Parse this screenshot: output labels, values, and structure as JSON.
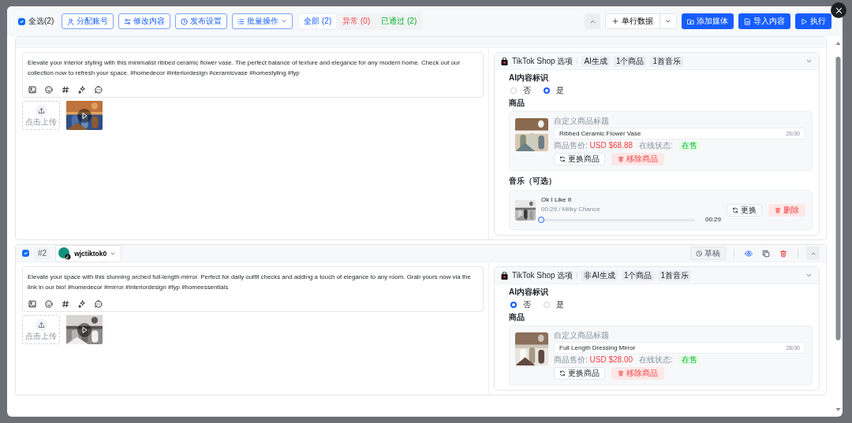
{
  "toolbar": {
    "select_all": {
      "label": "全选(2)",
      "checked": true
    },
    "actions": [
      {
        "label": "分配账号",
        "dropdown": false
      },
      {
        "label": "修改内容",
        "dropdown": false
      },
      {
        "label": "发布设置",
        "dropdown": false
      },
      {
        "label": "批量操作",
        "dropdown": true
      }
    ],
    "filters": [
      {
        "label": "全部 (2)",
        "kind": "all",
        "selected": true
      },
      {
        "label": "异常 (0)",
        "kind": "error",
        "selected": false
      },
      {
        "label": "已通过 (2)",
        "kind": "passed",
        "selected": false
      }
    ],
    "row_add": {
      "label": "单行数据"
    },
    "primary_buttons": [
      "添加媒体",
      "导入内容",
      "执行"
    ]
  },
  "posts": [
    {
      "caption": "Elevate your interior styling with this minimalist ribbed ceramic flower vase. The perfect balance of texture and elegance for any modern home. Check out our collection now to refresh your space. #homedecor #interiordesign #ceramicvase #homestyling #fyp",
      "upload_label": "点击上传",
      "shop": {
        "title": "TikTok Shop 选项",
        "tags": [
          "AI生成",
          "1个商品",
          "1首音乐"
        ],
        "ai_label": "AI内容标识",
        "options": [
          {
            "label": "否",
            "selected": false
          },
          {
            "label": "是",
            "selected": true
          }
        ],
        "product_heading": "商品",
        "product": {
          "title_label": "自定义商品标题",
          "name": "Ribbed Ceramic Flower Vase",
          "count": "26/30",
          "price_label": "商品售价:",
          "price": "USD $68.88",
          "status_label": "在线状态:",
          "status": "在售",
          "buttons": [
            "更换商品",
            "移除商品"
          ]
        },
        "music_heading": "音乐（可选）",
        "music": {
          "title": "Ok I Like It",
          "meta": "00:29 / Milky Chance",
          "level": 0,
          "time": "00:29",
          "buttons": [
            "更换",
            "删除"
          ]
        }
      }
    },
    {
      "checked": true,
      "number": "#2",
      "account": "wjctiktok0",
      "status": "草稿",
      "caption": "Elevate your space with this stunning arched full-length mirror. Perfect for daily outfit checks and adding a touch of elegance to any room. Grab yours now via the link in our bio! #homedecor #mirror #interiordesign #fyp #homeessentials",
      "upload_label": "点击上传",
      "shop": {
        "title": "TikTok Shop 选项",
        "tags": [
          "非AI生成",
          "1个商品",
          "1首音乐"
        ],
        "ai_label": "AI内容标识",
        "options": [
          {
            "label": "否",
            "selected": true
          },
          {
            "label": "是",
            "selected": false
          }
        ],
        "product_heading": "商品",
        "product": {
          "title_label": "自定义商品标题",
          "name": "Full Length Dressing Mirror",
          "count": "28/30",
          "price_label": "商品售价:",
          "price": "USD $28.00",
          "status_label": "在线状态:",
          "status": "在售",
          "buttons": [
            "更换商品",
            "移除商品"
          ]
        }
      }
    }
  ]
}
